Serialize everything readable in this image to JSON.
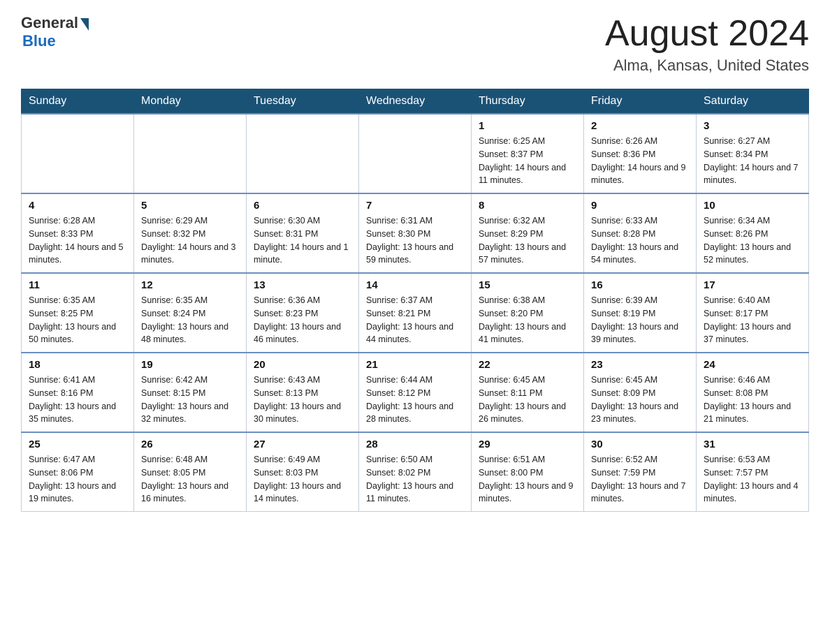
{
  "header": {
    "logo_general": "General",
    "logo_blue": "Blue",
    "month_year": "August 2024",
    "location": "Alma, Kansas, United States"
  },
  "days_of_week": [
    "Sunday",
    "Monday",
    "Tuesday",
    "Wednesday",
    "Thursday",
    "Friday",
    "Saturday"
  ],
  "weeks": [
    [
      {
        "day": "",
        "info": ""
      },
      {
        "day": "",
        "info": ""
      },
      {
        "day": "",
        "info": ""
      },
      {
        "day": "",
        "info": ""
      },
      {
        "day": "1",
        "info": "Sunrise: 6:25 AM\nSunset: 8:37 PM\nDaylight: 14 hours and 11 minutes."
      },
      {
        "day": "2",
        "info": "Sunrise: 6:26 AM\nSunset: 8:36 PM\nDaylight: 14 hours and 9 minutes."
      },
      {
        "day": "3",
        "info": "Sunrise: 6:27 AM\nSunset: 8:34 PM\nDaylight: 14 hours and 7 minutes."
      }
    ],
    [
      {
        "day": "4",
        "info": "Sunrise: 6:28 AM\nSunset: 8:33 PM\nDaylight: 14 hours and 5 minutes."
      },
      {
        "day": "5",
        "info": "Sunrise: 6:29 AM\nSunset: 8:32 PM\nDaylight: 14 hours and 3 minutes."
      },
      {
        "day": "6",
        "info": "Sunrise: 6:30 AM\nSunset: 8:31 PM\nDaylight: 14 hours and 1 minute."
      },
      {
        "day": "7",
        "info": "Sunrise: 6:31 AM\nSunset: 8:30 PM\nDaylight: 13 hours and 59 minutes."
      },
      {
        "day": "8",
        "info": "Sunrise: 6:32 AM\nSunset: 8:29 PM\nDaylight: 13 hours and 57 minutes."
      },
      {
        "day": "9",
        "info": "Sunrise: 6:33 AM\nSunset: 8:28 PM\nDaylight: 13 hours and 54 minutes."
      },
      {
        "day": "10",
        "info": "Sunrise: 6:34 AM\nSunset: 8:26 PM\nDaylight: 13 hours and 52 minutes."
      }
    ],
    [
      {
        "day": "11",
        "info": "Sunrise: 6:35 AM\nSunset: 8:25 PM\nDaylight: 13 hours and 50 minutes."
      },
      {
        "day": "12",
        "info": "Sunrise: 6:35 AM\nSunset: 8:24 PM\nDaylight: 13 hours and 48 minutes."
      },
      {
        "day": "13",
        "info": "Sunrise: 6:36 AM\nSunset: 8:23 PM\nDaylight: 13 hours and 46 minutes."
      },
      {
        "day": "14",
        "info": "Sunrise: 6:37 AM\nSunset: 8:21 PM\nDaylight: 13 hours and 44 minutes."
      },
      {
        "day": "15",
        "info": "Sunrise: 6:38 AM\nSunset: 8:20 PM\nDaylight: 13 hours and 41 minutes."
      },
      {
        "day": "16",
        "info": "Sunrise: 6:39 AM\nSunset: 8:19 PM\nDaylight: 13 hours and 39 minutes."
      },
      {
        "day": "17",
        "info": "Sunrise: 6:40 AM\nSunset: 8:17 PM\nDaylight: 13 hours and 37 minutes."
      }
    ],
    [
      {
        "day": "18",
        "info": "Sunrise: 6:41 AM\nSunset: 8:16 PM\nDaylight: 13 hours and 35 minutes."
      },
      {
        "day": "19",
        "info": "Sunrise: 6:42 AM\nSunset: 8:15 PM\nDaylight: 13 hours and 32 minutes."
      },
      {
        "day": "20",
        "info": "Sunrise: 6:43 AM\nSunset: 8:13 PM\nDaylight: 13 hours and 30 minutes."
      },
      {
        "day": "21",
        "info": "Sunrise: 6:44 AM\nSunset: 8:12 PM\nDaylight: 13 hours and 28 minutes."
      },
      {
        "day": "22",
        "info": "Sunrise: 6:45 AM\nSunset: 8:11 PM\nDaylight: 13 hours and 26 minutes."
      },
      {
        "day": "23",
        "info": "Sunrise: 6:45 AM\nSunset: 8:09 PM\nDaylight: 13 hours and 23 minutes."
      },
      {
        "day": "24",
        "info": "Sunrise: 6:46 AM\nSunset: 8:08 PM\nDaylight: 13 hours and 21 minutes."
      }
    ],
    [
      {
        "day": "25",
        "info": "Sunrise: 6:47 AM\nSunset: 8:06 PM\nDaylight: 13 hours and 19 minutes."
      },
      {
        "day": "26",
        "info": "Sunrise: 6:48 AM\nSunset: 8:05 PM\nDaylight: 13 hours and 16 minutes."
      },
      {
        "day": "27",
        "info": "Sunrise: 6:49 AM\nSunset: 8:03 PM\nDaylight: 13 hours and 14 minutes."
      },
      {
        "day": "28",
        "info": "Sunrise: 6:50 AM\nSunset: 8:02 PM\nDaylight: 13 hours and 11 minutes."
      },
      {
        "day": "29",
        "info": "Sunrise: 6:51 AM\nSunset: 8:00 PM\nDaylight: 13 hours and 9 minutes."
      },
      {
        "day": "30",
        "info": "Sunrise: 6:52 AM\nSunset: 7:59 PM\nDaylight: 13 hours and 7 minutes."
      },
      {
        "day": "31",
        "info": "Sunrise: 6:53 AM\nSunset: 7:57 PM\nDaylight: 13 hours and 4 minutes."
      }
    ]
  ]
}
